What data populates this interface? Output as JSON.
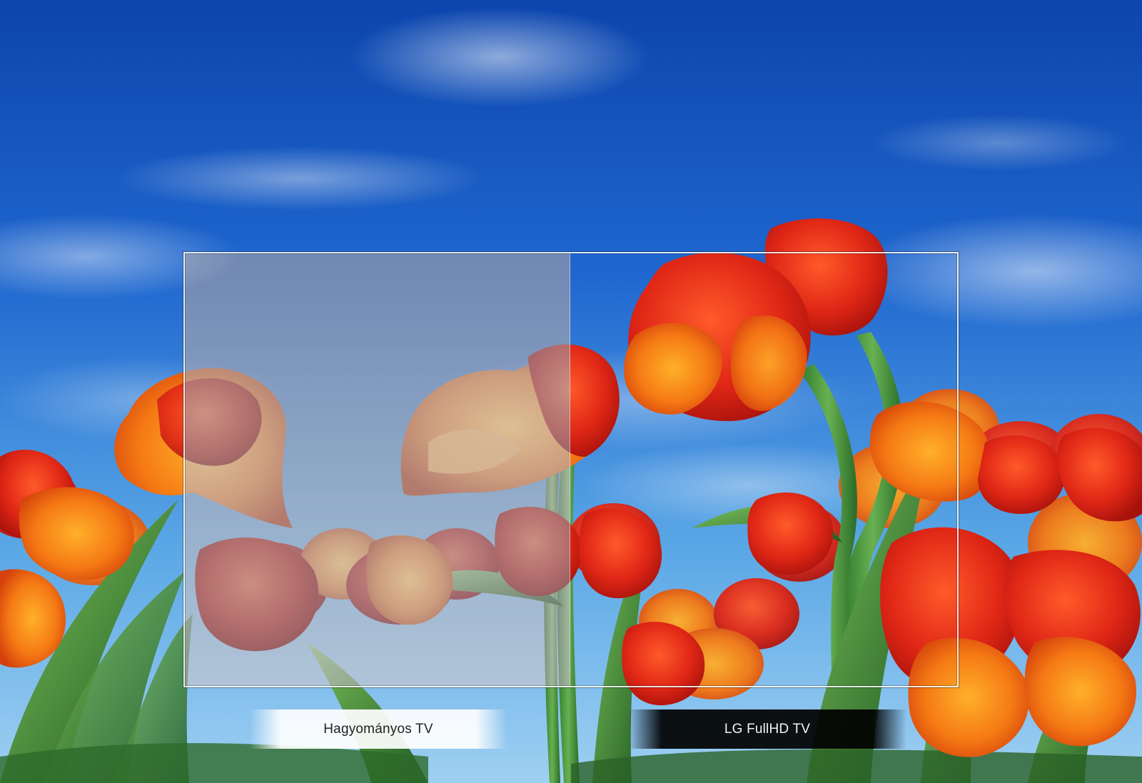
{
  "comparison": {
    "left_label": "Hagyományos TV",
    "right_label": "LG FullHD TV"
  },
  "colors": {
    "sky_top": "#0f4fb8",
    "sky_bottom": "#6fb7e8",
    "tulip_red": "#e0281a",
    "tulip_orange": "#f58a1c",
    "stem_green": "#3f8f3a"
  }
}
